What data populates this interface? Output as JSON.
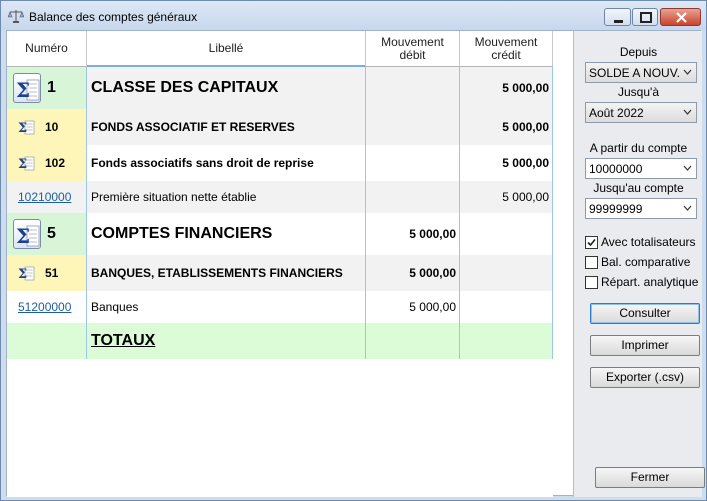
{
  "window": {
    "title": "Balance des comptes généraux"
  },
  "table": {
    "headers": {
      "numero": "Numéro",
      "libelle": "Libellé",
      "debit_line1": "Mouvement",
      "debit_line2": "débit",
      "credit_line1": "Mouvement",
      "credit_line2": "crédit"
    },
    "rows": [
      {
        "kind": "classe",
        "numero": "1",
        "libelle": "CLASSE DES CAPITAUX",
        "debit": "",
        "credit": "5 000,00",
        "bg": "#f2f2f2",
        "num_bg": "#d8f5d8"
      },
      {
        "kind": "group",
        "numero": "10",
        "libelle": "FONDS ASSOCIATIF ET RESERVES",
        "debit": "",
        "credit": "5 000,00",
        "bg": "#f2f2f2",
        "num_bg": "#fdf6b8"
      },
      {
        "kind": "group",
        "numero": "102",
        "libelle": "Fonds associatifs sans droit de reprise",
        "debit": "",
        "credit": "5 000,00",
        "bg": "#ffffff",
        "num_bg": "#fdf6b8"
      },
      {
        "kind": "account",
        "numero": "10210000",
        "libelle": "Première situation nette établie",
        "debit": "",
        "credit": "5 000,00",
        "bg": "#f2f2f2",
        "num_bg": "#f2f2f2"
      },
      {
        "kind": "classe",
        "numero": "5",
        "libelle": "COMPTES FINANCIERS",
        "debit": "5 000,00",
        "credit": "",
        "bg": "#ffffff",
        "num_bg": "#d8f5d8"
      },
      {
        "kind": "group",
        "numero": "51",
        "libelle": "BANQUES, ETABLISSEMENTS FINANCIERS",
        "debit": "5 000,00",
        "credit": "",
        "bg": "#f2f2f2",
        "num_bg": "#fdf6b8"
      },
      {
        "kind": "account",
        "numero": "51200000",
        "libelle": "Banques",
        "debit": "5 000,00",
        "credit": "",
        "bg": "#ffffff",
        "num_bg": "#ffffff"
      },
      {
        "kind": "total",
        "numero": "",
        "libelle": "TOTAUX",
        "debit": "",
        "credit": "",
        "bg": "#dcfcd8",
        "num_bg": "#dcfcd8"
      }
    ]
  },
  "panel": {
    "depuis_label": "Depuis",
    "depuis_value": "SOLDE A NOUV.",
    "jusqua_label": "Jusqu'à",
    "jusqua_value": "Août 2022",
    "from_account_label": "A partir du compte",
    "from_account_value": "10000000",
    "to_account_label": "Jusqu'au compte",
    "to_account_value": "99999999",
    "checkboxes": {
      "totalisateurs": {
        "label": "Avec totalisateurs",
        "checked": true
      },
      "comparative": {
        "label": "Bal. comparative",
        "checked": false
      },
      "analytique": {
        "label": "Répart. analytique",
        "checked": false
      }
    },
    "buttons": {
      "consulter": "Consulter",
      "imprimer": "Imprimer",
      "exporter": "Exporter (.csv)",
      "fermer": "Fermer"
    }
  },
  "colors": {
    "classe_num_bg": "#d8f5d8",
    "group_num_bg": "#fdf6b8",
    "total_bg": "#dcfcd8",
    "link": "#1f5e9e"
  }
}
